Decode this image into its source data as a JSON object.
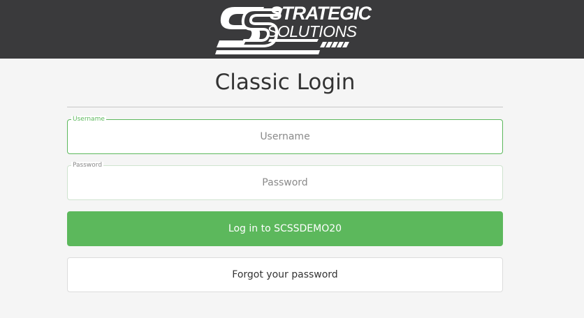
{
  "header": {
    "logo": {
      "line1": "STRATEGIC",
      "line2": "SOLUTIONS",
      "icon": "ss-monogram-logo",
      "background_color": "#3a3a3c"
    }
  },
  "main": {
    "title": "Classic Login",
    "username": {
      "label": "Username",
      "placeholder": "Username",
      "value": ""
    },
    "password": {
      "label": "Password",
      "placeholder": "Password",
      "value": ""
    },
    "login_button_label": "Log in to SCSSDEMO20",
    "forgot_button_label": "Forgot your password"
  },
  "colors": {
    "accent": "#5cb85c",
    "header": "#3a3a3c",
    "page_background": "#f5f5f5",
    "title_text": "#333333"
  }
}
